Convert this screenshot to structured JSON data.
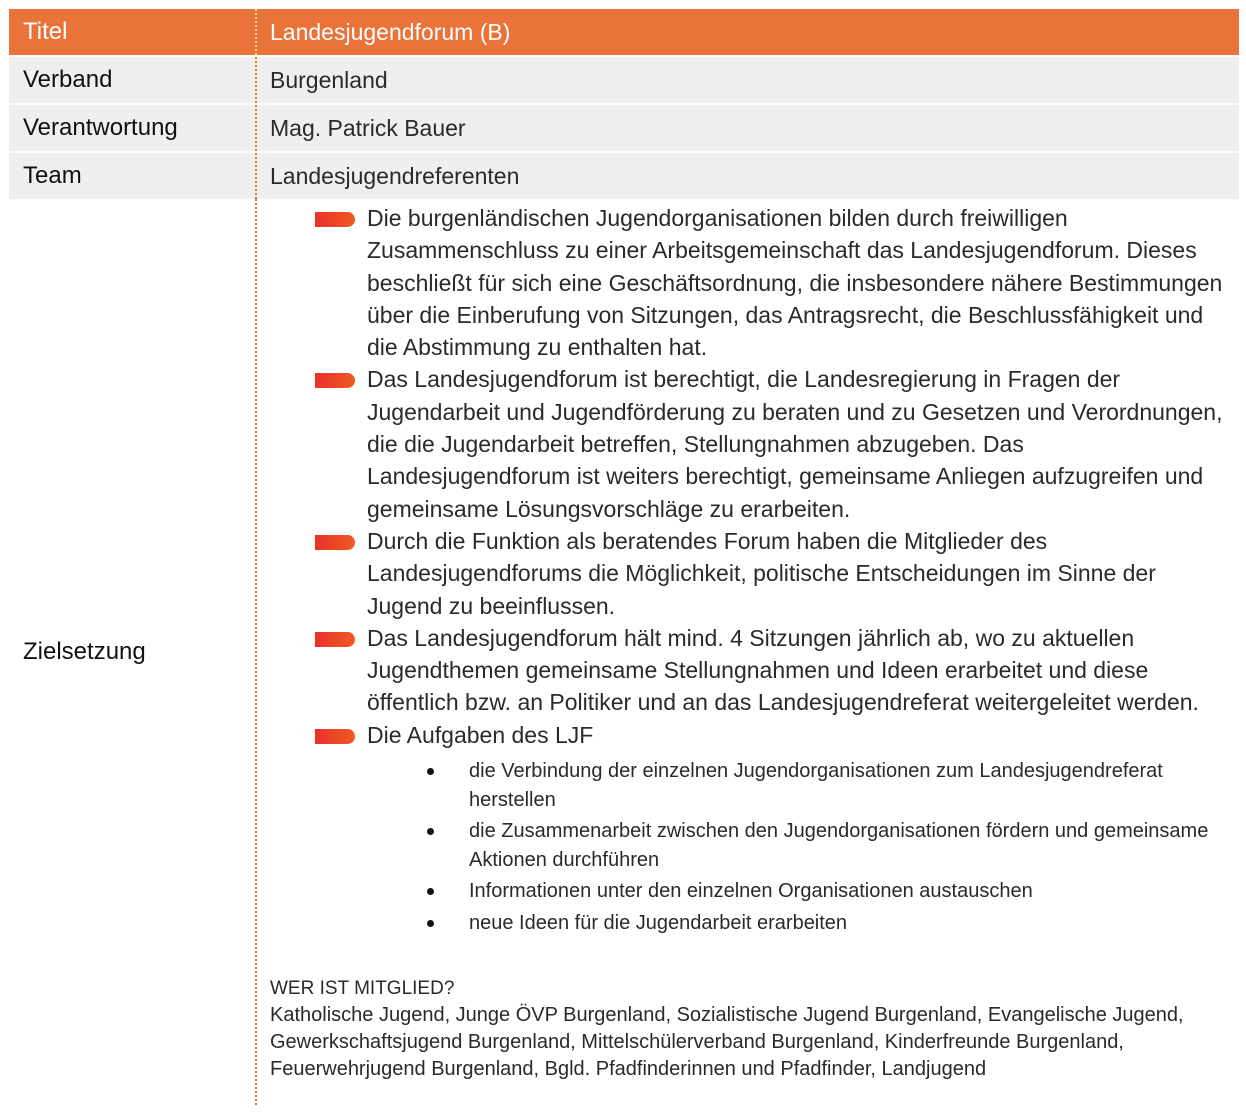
{
  "header": {
    "label": "Titel",
    "value": "Landesjugendforum (B)"
  },
  "rows": [
    {
      "label": "Verband",
      "value": "Burgenland"
    },
    {
      "label": "Verantwortung",
      "value": "Mag. Patrick Bauer"
    },
    {
      "label": "Team",
      "value": "Landesjugendreferenten"
    }
  ],
  "goals": {
    "label": "Zielsetzung",
    "bullets": [
      "Die burgenländischen Jugendorganisationen bilden durch freiwilligen Zusammenschluss zu einer Arbeitsgemeinschaft das Landesjugendforum. Dieses beschließt für sich eine Geschäftsordnung, die insbesondere nähere Bestimmungen über die Einberufung von Sitzungen, das Antragsrecht, die Beschlussfähigkeit und die Abstimmung zu enthalten hat.",
      "Das Landesjugendforum ist berechtigt, die Landesregierung in Fragen der Jugendarbeit und Jugendförderung zu beraten und zu Gesetzen und Verordnungen, die die Jugendarbeit betreffen, Stellungnahmen abzugeben. Das Landesjugendforum ist weiters berechtigt, gemeinsame Anliegen aufzugreifen und gemeinsame Lösungsvorschläge zu erarbeiten.",
      "Durch die Funktion als beratendes Forum haben die Mitglieder des Landesjugendforums die Möglichkeit, politische Entscheidungen im Sinne der Jugend zu beeinflussen.",
      "Das Landesjugendforum hält mind. 4 Sitzungen jährlich ab, wo zu aktuellen Jugendthemen gemeinsame Stellungnahmen und Ideen erarbeitet und diese öffentlich bzw. an Politiker und an das Landesjugendreferat weitergeleitet werden.",
      "Die Aufgaben des LJF"
    ],
    "tasks": [
      "die Verbindung der einzelnen Jugendorganisationen zum Landesjugendreferat herstellen",
      "die Zusammenarbeit zwischen den Jugendorganisationen fördern und gemeinsame Aktionen durchführen",
      "Informationen unter den einzelnen Organisationen austauschen",
      "neue Ideen für die Jugendarbeit erarbeiten"
    ],
    "members_heading": "WER IST MITGLIED?",
    "members_text": "Katholische Jugend, Junge ÖVP Burgenland, Sozialistische Jugend Burgenland, Evangelische Jugend, Gewerkschaftsjugend Burgenland, Mittelschülerverband Burgenland, Kinderfreunde Burgenland, Feuerwehrjugend Burgenland, Bgld. Pfadfinderinnen und Pfadfinder, Landjugend"
  },
  "colors": {
    "header_bg": "#ea7339",
    "row_bg": "#efefef",
    "bullet_bar": "#e8312a"
  }
}
